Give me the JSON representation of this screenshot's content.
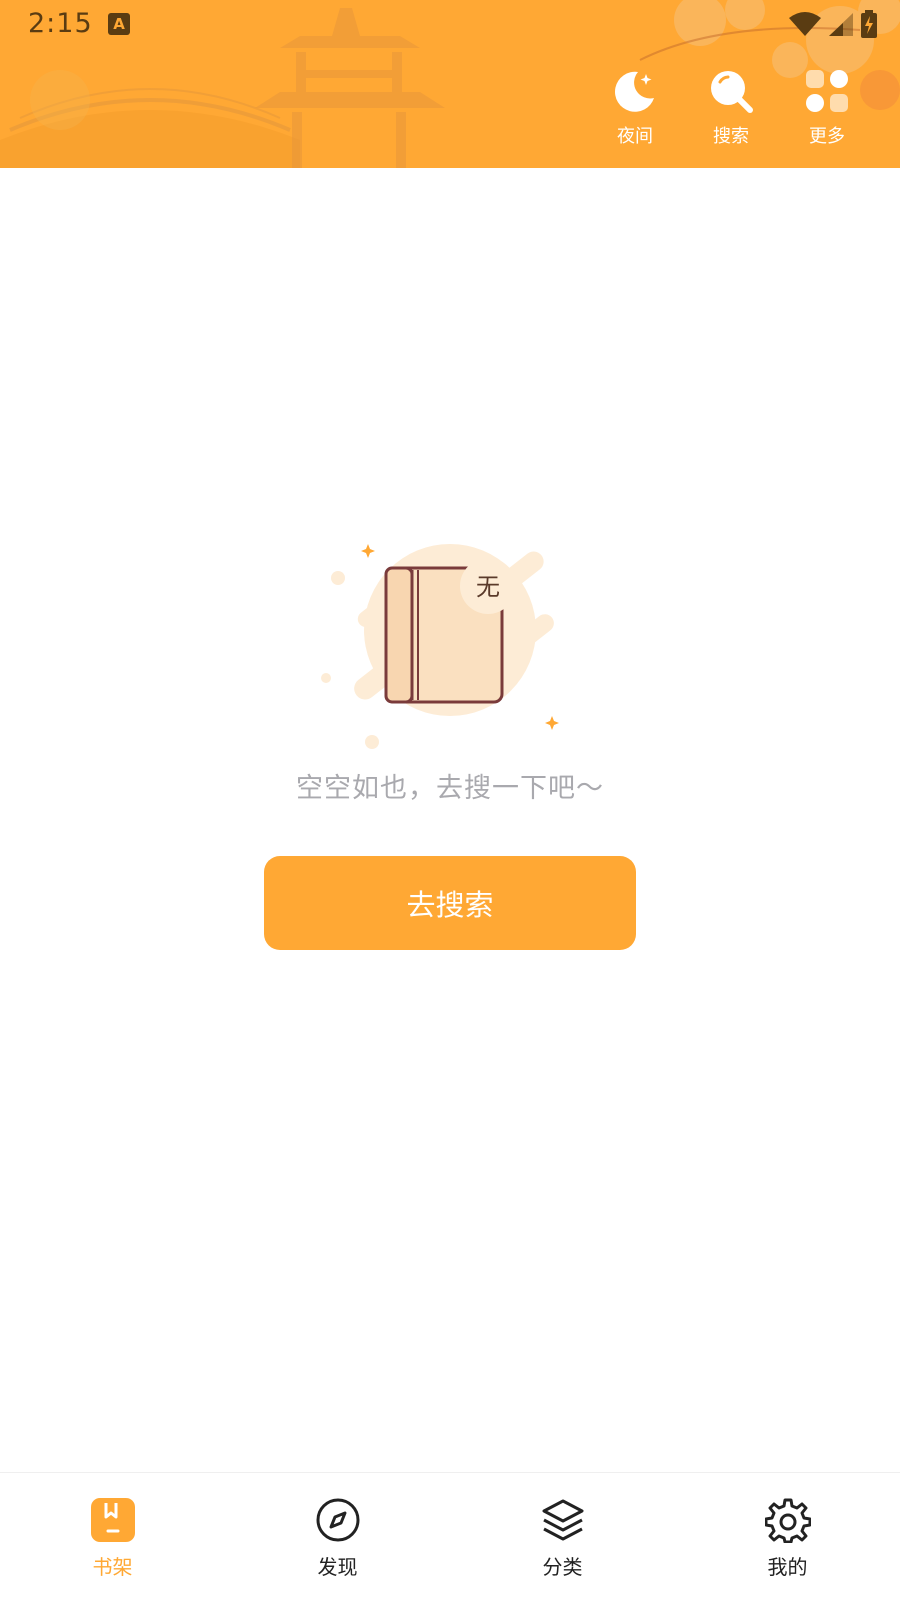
{
  "status_bar": {
    "time": "2:15",
    "app_icon": "A"
  },
  "header": {
    "actions": [
      {
        "label": "夜间",
        "icon": "moon-icon"
      },
      {
        "label": "搜索",
        "icon": "search-icon"
      },
      {
        "label": "更多",
        "icon": "grid-icon"
      }
    ]
  },
  "empty_state": {
    "badge": "无",
    "message": "空空如也，去搜一下吧～",
    "button_label": "去搜索"
  },
  "bottom_nav": {
    "items": [
      {
        "label": "书架",
        "icon": "bookshelf-icon",
        "active": true
      },
      {
        "label": "发现",
        "icon": "compass-icon",
        "active": false
      },
      {
        "label": "分类",
        "icon": "layers-icon",
        "active": false
      },
      {
        "label": "我的",
        "icon": "settings-icon",
        "active": false
      }
    ]
  },
  "colors": {
    "accent": "#FFA834",
    "empty_text": "#A9A9AE",
    "book_outline": "#7A3B3B",
    "book_fill": "#FAE0C0"
  }
}
